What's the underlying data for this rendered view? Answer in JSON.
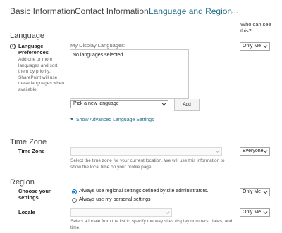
{
  "tabs": {
    "basic": "Basic Information",
    "contact": "Contact Information",
    "language": "Language and Region",
    "more": "..."
  },
  "who_can_see": "Who can see this?",
  "language": {
    "section_title": "Language",
    "label_line1": "Language",
    "label_line2": "Preferences",
    "desc": [
      "Add one or more",
      "languages and sort",
      "them by priority.",
      "SharePoint will use",
      "these languages when",
      "available."
    ],
    "display_label": "My Display Languages:",
    "list_empty": "No languages selected",
    "picker": "Pick a new language",
    "add_button": "Add",
    "advanced_link": "Show Advanced Language Settings",
    "privacy": "Only Me"
  },
  "timezone": {
    "section_title": "Time Zone",
    "label": "Time Zone",
    "note_line1": "Select the time zone for your current location. We will use this information to",
    "note_line2": "show the local time on your profile page.",
    "privacy": "Everyone"
  },
  "region": {
    "section_title": "Region",
    "choose_line1": "Choose your",
    "choose_line2": "settings",
    "option_admin": "Always use regional settings defined by site administrators.",
    "option_personal": "Always use my personal settings",
    "privacy_choose": "Only Me",
    "locale_label": "Locale",
    "locale_note_line1": "Select a locale from the list to specify the way sites display numbers, dates, and",
    "locale_note_line2": "time.",
    "privacy_locale": "Only Me"
  },
  "colors": {
    "accent": "#1f6f8b",
    "radio_selected": "#0078d4"
  }
}
